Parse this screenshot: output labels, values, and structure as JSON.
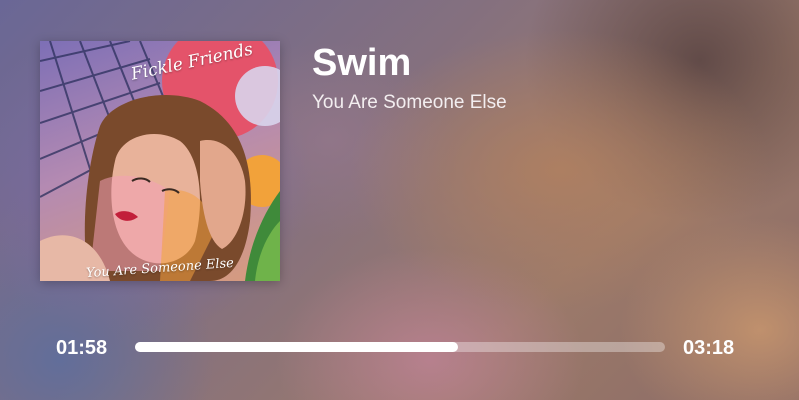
{
  "track": {
    "title": "Swim",
    "artist": "You Are Someone Else"
  },
  "cover": {
    "artist_text": "Fickle Friends",
    "album_text": "You Are Someone Else"
  },
  "playback": {
    "elapsed": "01:58",
    "total": "03:18",
    "progress": 0.61
  },
  "colors": {
    "text": "#ffffff",
    "progress_fill": "#ffffff",
    "progress_track": "rgba(255,255,255,0.35)"
  }
}
